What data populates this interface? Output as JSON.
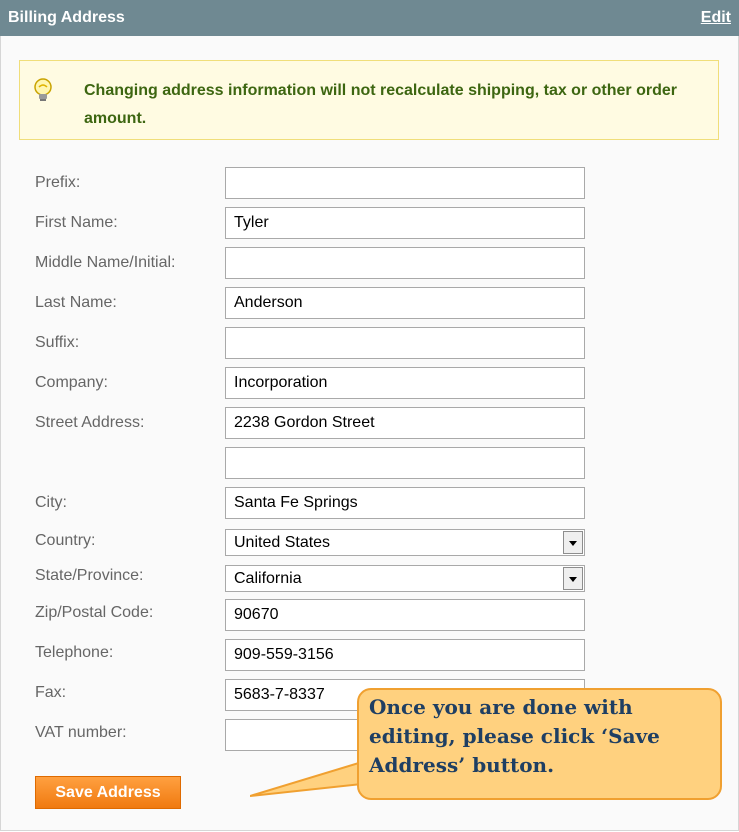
{
  "header": {
    "title": "Billing Address",
    "edit_label": "Edit"
  },
  "notice": {
    "icon": "lightbulb-icon",
    "text": "Changing address information will not recalculate shipping, tax or other order amount."
  },
  "fields": {
    "prefix": {
      "label": "Prefix:",
      "value": ""
    },
    "first_name": {
      "label": "First Name:",
      "value": "Tyler"
    },
    "middle_name": {
      "label": "Middle Name/Initial:",
      "value": ""
    },
    "last_name": {
      "label": "Last Name:",
      "value": "Anderson"
    },
    "suffix": {
      "label": "Suffix:",
      "value": ""
    },
    "company": {
      "label": "Company:",
      "value": "Incorporation"
    },
    "street": {
      "label": "Street Address:",
      "line1": "2238 Gordon Street",
      "line2": ""
    },
    "city": {
      "label": "City:",
      "value": "Santa Fe Springs"
    },
    "country": {
      "label": "Country:",
      "value": "United States"
    },
    "state": {
      "label": "State/Province:",
      "value": "California"
    },
    "zip": {
      "label": "Zip/Postal Code:",
      "value": "90670"
    },
    "telephone": {
      "label": "Telephone:",
      "value": "909-559-3156"
    },
    "fax": {
      "label": "Fax:",
      "value": "5683-7-8337"
    },
    "vat": {
      "label": "VAT number:",
      "value": ""
    }
  },
  "save_button": {
    "label": "Save Address"
  },
  "callout": {
    "text": "Once you are done with editing, please click ‘Save Address’ button."
  },
  "colors": {
    "header": "#6f8992",
    "notice_bg": "#fffbe2",
    "notice_text": "#3d6611",
    "button": "#f07a10",
    "callout_bg": "#ffd17f",
    "callout_text": "#1f3f63"
  }
}
